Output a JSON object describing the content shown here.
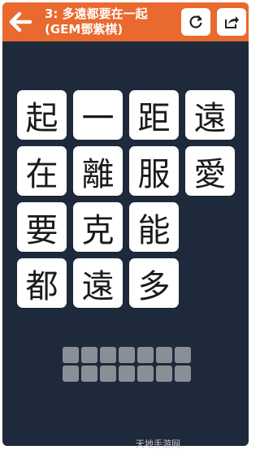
{
  "header": {
    "title_line1": "3: 多遠都要在一起",
    "title_line2": "(GEM鄧紫棋)",
    "back_icon": "arrow-left-icon",
    "refresh_icon": "refresh-icon",
    "share_icon": "share-icon"
  },
  "tiles": [
    "起",
    "一",
    "距",
    "遠",
    "在",
    "離",
    "服",
    "愛",
    "要",
    "克",
    "能",
    "都",
    "遠",
    "多"
  ],
  "answer_slot_count": 14,
  "watermark": "天地手游网",
  "colors": {
    "header": "#e9692e",
    "background": "#1e2a3b",
    "tile": "#ffffff",
    "slot": "#8a8f96"
  }
}
